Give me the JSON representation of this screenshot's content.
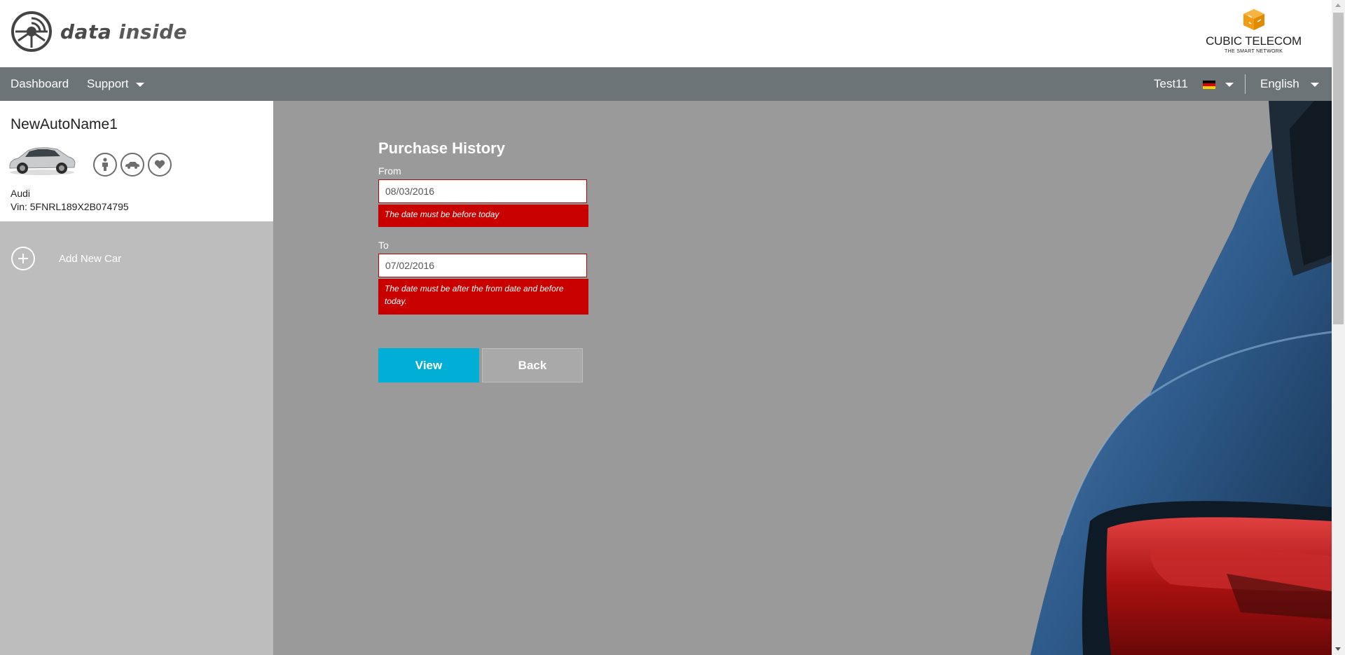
{
  "header": {
    "logo": {
      "text_data": "data",
      "text_inside": "inside"
    },
    "partner": {
      "name": "CUBIC TELECOM",
      "tagline": "THE SMART NETWORK"
    }
  },
  "nav": {
    "items": [
      {
        "label": "Dashboard"
      },
      {
        "label": "Support"
      }
    ],
    "user": "Test11",
    "language": "English",
    "flag_colors": [
      "#000000",
      "#dd0000",
      "#ffce00"
    ]
  },
  "sidebar": {
    "car": {
      "name": "NewAutoName1",
      "make": "Audi",
      "vin": "Vin: 5FNRL189X2B074795",
      "icons": [
        "person-icon",
        "car-icon",
        "heart-icon"
      ]
    },
    "add_car_label": "Add New Car"
  },
  "main": {
    "title": "Purchase History",
    "from": {
      "label": "From",
      "value": "08/03/2016",
      "error": "The date must be before today"
    },
    "to": {
      "label": "To",
      "value": "07/02/2016",
      "error": "The date must be after the from date and before today."
    },
    "buttons": {
      "view": "View",
      "back": "Back"
    }
  },
  "colors": {
    "navbar": "#6d7478",
    "main_bg": "#9a9a9a",
    "sidebar_bg": "#bdbdbd",
    "error": "#c80000",
    "primary_button": "#00aed6",
    "secondary_button": "#a9a9a9",
    "brand_orange": "#f39c12"
  }
}
